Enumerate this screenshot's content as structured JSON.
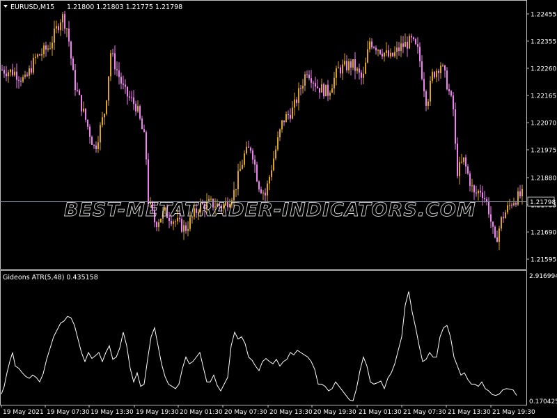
{
  "header": {
    "symbol_label": "EURUSD,M15",
    "ohlc": "1.21800 1.21803 1.21775 1.21798"
  },
  "watermark": "BEST-METATRADER-INDICATORS.COM",
  "price_axis": {
    "ticks": [
      "1.22455",
      "1.22355",
      "1.22260",
      "1.22165",
      "1.22070",
      "1.21975",
      "1.21880",
      "1.21785",
      "1.21690",
      "1.21595"
    ],
    "current_price": "1.21798"
  },
  "indicator": {
    "label": "Gideons ATR(5,48) 0.435158",
    "max_label": "2.916994",
    "min_label": "0.170425"
  },
  "time_axis": {
    "labels": [
      "19 May 2021",
      "19 May 07:30",
      "19 May 13:30",
      "19 May 19:30",
      "20 May 01:30",
      "20 May 07:30",
      "20 May 13:30",
      "20 May 19:30",
      "21 May 01:30",
      "21 May 07:30",
      "21 May 13:30",
      "21 May 19:30"
    ]
  },
  "colors": {
    "background": "#000000",
    "bull_candle": "#DAA520",
    "bear_candle": "#EE82EE",
    "indicator_line": "#FFFFFF",
    "frame": "#C0C0C0",
    "price_line": "#8090A0"
  },
  "chart_data": [
    {
      "type": "candlestick",
      "symbol": "EURUSD",
      "timeframe": "M15",
      "ylim": [
        1.2155,
        1.225
      ],
      "price_keyframes": {
        "x_labels": [
          "19 May 2021",
          "19 May 07:30",
          "19 May 13:30",
          "19 May 19:30",
          "20 May 01:30",
          "20 May 07:30",
          "20 May 13:30",
          "20 May 19:30",
          "21 May 01:30",
          "21 May 07:30",
          "21 May 13:30",
          "21 May 19:30"
        ],
        "approx_close": [
          1.2225,
          1.2238,
          1.2192,
          1.2178,
          1.2175,
          1.2196,
          1.222,
          1.2232,
          1.2234,
          1.2237,
          1.2188,
          1.2182
        ]
      },
      "current_price": 1.21798
    },
    {
      "type": "line",
      "name": "Gideons ATR(5,48)",
      "ylim": [
        0.170425,
        2.916994
      ],
      "last_value": 0.435158,
      "x": [
        0,
        4,
        8,
        12,
        16,
        20,
        25,
        30,
        35,
        40,
        45,
        50,
        55,
        60,
        65,
        70,
        75,
        80,
        85,
        90,
        95,
        100,
        105,
        110,
        115,
        120,
        125,
        130,
        135,
        140,
        145,
        150,
        155,
        160,
        165,
        170,
        175,
        180,
        185,
        190,
        195,
        200,
        205,
        210,
        215,
        220,
        225,
        230,
        235,
        240,
        245,
        250,
        255,
        260,
        265,
        270,
        275,
        280,
        285,
        290,
        295,
        300,
        305,
        310,
        315,
        320,
        325,
        330,
        335,
        340,
        345,
        350,
        355,
        360,
        365,
        370,
        375,
        380,
        385,
        390,
        395,
        400,
        405,
        410,
        415,
        420,
        425,
        430,
        435,
        440,
        445,
        450,
        455,
        460,
        465,
        470,
        475,
        480,
        485,
        490,
        495,
        500,
        505,
        510,
        515,
        520,
        525,
        530,
        535,
        540,
        545,
        550,
        555,
        560,
        565,
        570,
        575,
        580,
        585,
        590,
        595,
        600,
        605,
        610,
        615,
        620,
        625,
        630,
        635,
        640,
        645,
        650,
        655,
        660,
        665,
        670,
        675,
        680,
        685,
        690,
        695,
        700,
        705,
        710,
        715,
        720,
        725,
        730,
        735,
        740,
        745,
        750
      ],
      "values": [
        0.33,
        0.5,
        0.8,
        1.05,
        1.25,
        0.95,
        0.9,
        0.8,
        0.72,
        0.68,
        0.75,
        0.7,
        0.6,
        0.78,
        1.1,
        1.35,
        1.6,
        1.75,
        1.9,
        1.95,
        2.05,
        2.02,
        1.85,
        1.55,
        1.25,
        1.05,
        1.25,
        1.12,
        1.18,
        1.25,
        1.05,
        1.25,
        1.4,
        1.1,
        1.15,
        1.35,
        1.7,
        1.4,
        0.9,
        0.6,
        0.8,
        0.5,
        0.55,
        1.1,
        1.6,
        1.8,
        1.4,
        1.0,
        0.72,
        0.55,
        0.5,
        0.45,
        0.55,
        0.9,
        1.15,
        1.0,
        1.05,
        1.15,
        1.25,
        0.92,
        0.6,
        0.6,
        0.75,
        0.52,
        0.4,
        0.55,
        0.7,
        1.4,
        1.7,
        1.55,
        1.6,
        1.45,
        1.15,
        1.08,
        0.95,
        0.85,
        1.05,
        1.12,
        1.05,
        1.0,
        1.1,
        0.95,
        1.05,
        1.1,
        1.25,
        1.2,
        1.3,
        1.25,
        1.2,
        1.15,
        1.05,
        0.88,
        0.55,
        0.55,
        0.5,
        0.4,
        0.45,
        0.6,
        0.5,
        0.4,
        0.3,
        0.2,
        0.18,
        0.45,
        0.85,
        1.15,
        0.95,
        0.6,
        0.55,
        0.58,
        0.62,
        0.45,
        0.68,
        0.8,
        1.0,
        1.3,
        1.6,
        2.3,
        2.6,
        2.15,
        1.8,
        1.4,
        1.05,
        1.1,
        1.25,
        1.15,
        1.15,
        1.6,
        1.8,
        1.85,
        1.6,
        1.15,
        0.95,
        0.75,
        0.8,
        0.65,
        0.55,
        0.55,
        0.5,
        0.6,
        0.45,
        0.4,
        0.32,
        0.3,
        0.33,
        0.42,
        0.45,
        0.44,
        0.42,
        0.3
      ]
    }
  ]
}
